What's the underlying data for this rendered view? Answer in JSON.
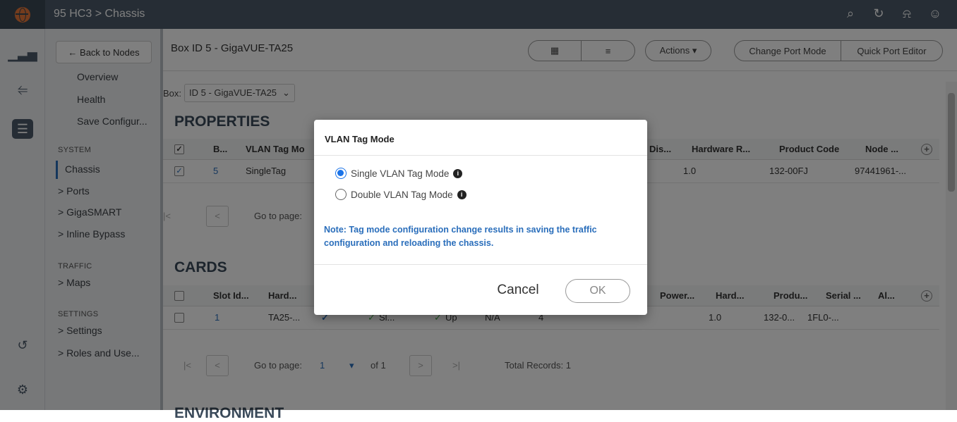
{
  "topbar": {
    "breadcrumb": "95 HC3 > Chassis"
  },
  "nav": {
    "back_label": "← Back to Nodes",
    "items": [
      "Overview",
      "Health",
      "Save Configur..."
    ],
    "system_label": "SYSTEM",
    "system_items": [
      "Chassis",
      "> Ports",
      "> GigaSMART",
      "> Inline Bypass"
    ],
    "traffic_label": "TRAFFIC",
    "traffic_items": [
      "> Maps"
    ],
    "settings_label": "SETTINGS",
    "settings_items": [
      "> Settings",
      "> Roles and Use..."
    ]
  },
  "header": {
    "box_title": "Box ID 5 - GigaVUE-TA25",
    "actions_label": "Actions ▾",
    "change_port_mode": "Change Port Mode",
    "quick_port_editor": "Quick Port Editor"
  },
  "box_select": {
    "label": "Box:",
    "value": "ID 5 - GigaVUE-TA25"
  },
  "properties": {
    "title": "PROPERTIES",
    "columns": [
      "B...",
      "VLAN Tag Mo",
      "Dis...",
      "Hardware R...",
      "Product Code",
      "Node ..."
    ],
    "row": {
      "box": "5",
      "vlan": "SingleTag",
      "hw": "1.0",
      "product": "132-00FJ",
      "node": "97441961-..."
    }
  },
  "pager1": {
    "goto": "Go to page:"
  },
  "cards": {
    "title": "CARDS",
    "columns": [
      "Slot Id...",
      "Hard...",
      "Power...",
      "Hard...",
      "Produ...",
      "Serial ...",
      "Al..."
    ],
    "row": {
      "slot": "1",
      "hw": "TA25-...",
      "status1": "Sl...",
      "status2": "Up",
      "na": "N/A",
      "num": "4",
      "hw2": "1.0",
      "prod": "132-0...",
      "serial": "1FL0-..."
    }
  },
  "pager2": {
    "goto": "Go to page:",
    "page": "1",
    "of": "of 1",
    "total": "Total Records: 1"
  },
  "env": {
    "title": "ENVIRONMENT"
  },
  "modal": {
    "title": "VLAN Tag Mode",
    "option1": "Single VLAN Tag Mode",
    "option2": "Double VLAN Tag Mode",
    "selected": "Single VLAN Tag Mode",
    "note": "Note: Tag mode configuration change results in saving the traffic configuration and reloading the chassis.",
    "cancel": "Cancel",
    "ok": "OK"
  }
}
